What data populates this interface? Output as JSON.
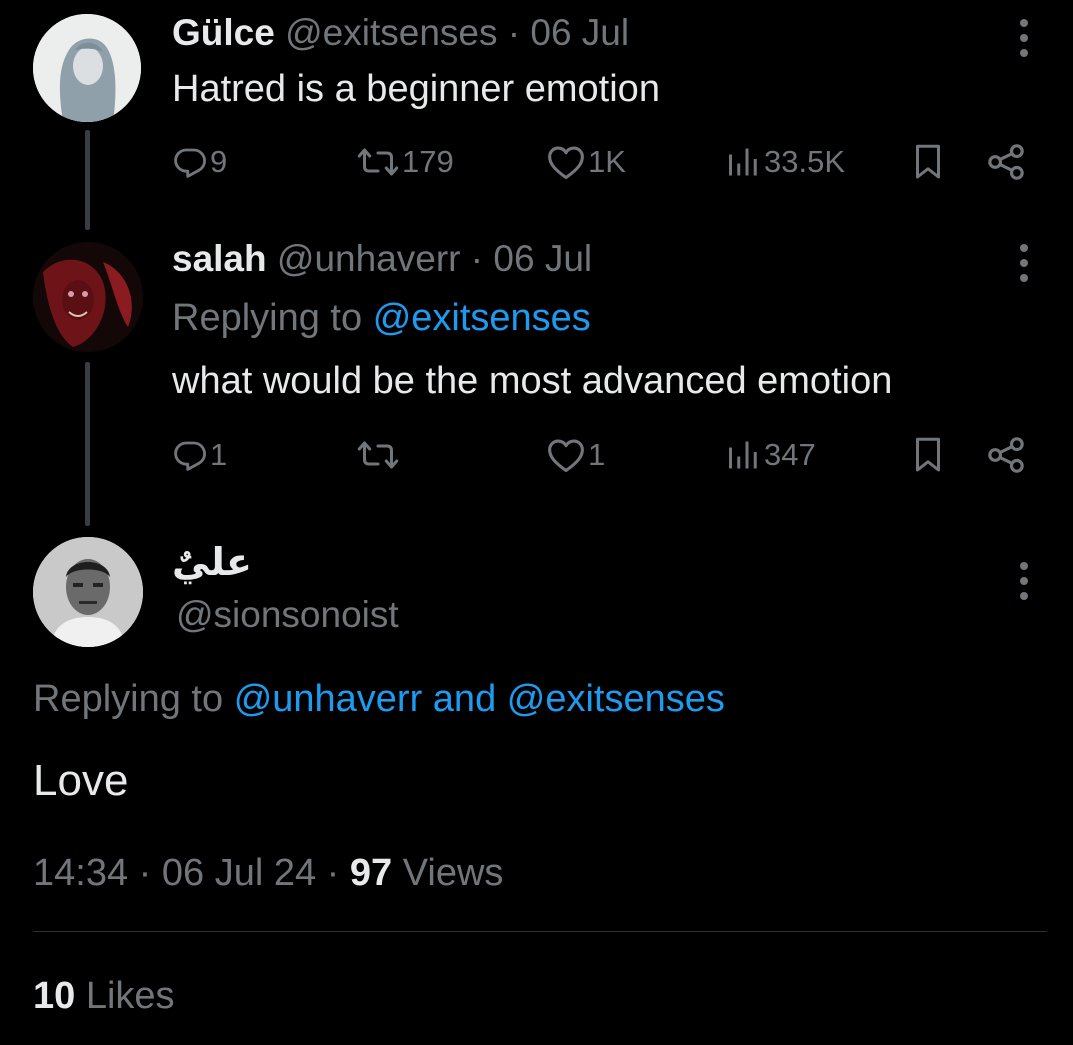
{
  "tweets": [
    {
      "name": "Gülce",
      "handle": "@exitsenses",
      "separator": "·",
      "date": "06 Jul",
      "text": "Hatred is a beginner emotion",
      "replies": "9",
      "retweets": "179",
      "likes": "1K",
      "views": "33.5K"
    },
    {
      "name": "salah",
      "handle": "@unhaverr",
      "separator": "·",
      "date": "06 Jul",
      "replying_prefix": "Replying to",
      "replying_to": "@exitsenses",
      "text": "what would be the most advanced emotion",
      "replies": "1",
      "retweets": "",
      "likes": "1",
      "views": "347"
    }
  ],
  "focused": {
    "name": "عليٌ",
    "handle": "@sionsonoist",
    "replying_prefix": "Replying to",
    "replying_to": "@unhaverr and @exitsenses",
    "text": "Love",
    "time": "14:34",
    "date": "06 Jul 24",
    "separator": "·",
    "views_count": "97",
    "views_label": "Views",
    "likes_count": "10",
    "likes_label": "Likes"
  },
  "icons": {
    "reply": "reply-icon",
    "retweet": "retweet-icon",
    "like": "heart-icon",
    "views": "views-chart-icon",
    "bookmark": "bookmark-icon",
    "share": "share-icon",
    "more": "more-vertical-icon"
  },
  "colors": {
    "background": "#000000",
    "text": "#e7e9ea",
    "muted": "#71767b",
    "link": "#1d9bf0"
  }
}
